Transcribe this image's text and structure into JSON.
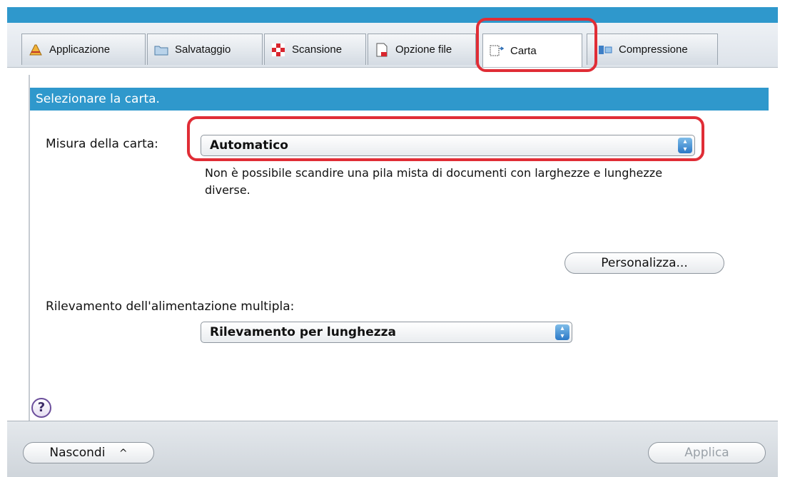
{
  "tabs": [
    {
      "label": "Applicazione"
    },
    {
      "label": "Salvataggio"
    },
    {
      "label": "Scansione"
    },
    {
      "label": "Opzione file"
    },
    {
      "label": "Carta"
    },
    {
      "label": "Compressione"
    }
  ],
  "header": "Selezionare la carta.",
  "paper_size": {
    "label": "Misura della carta:",
    "value": "Automatico",
    "note_line1": "Non è possibile scandire una pila mista di documenti con larghezze e lunghezze",
    "note_line2": "diverse."
  },
  "customize_button": "Personalizza...",
  "multifeed": {
    "label": "Rilevamento dell'alimentazione multipla:",
    "value": "Rilevamento per lunghezza"
  },
  "help": "?",
  "bottom": {
    "hide_label": "Nascondi",
    "hide_icon": "^",
    "apply_label": "Applica"
  },
  "colors": {
    "accent": "#2f98cc",
    "highlight": "#e02d36"
  }
}
